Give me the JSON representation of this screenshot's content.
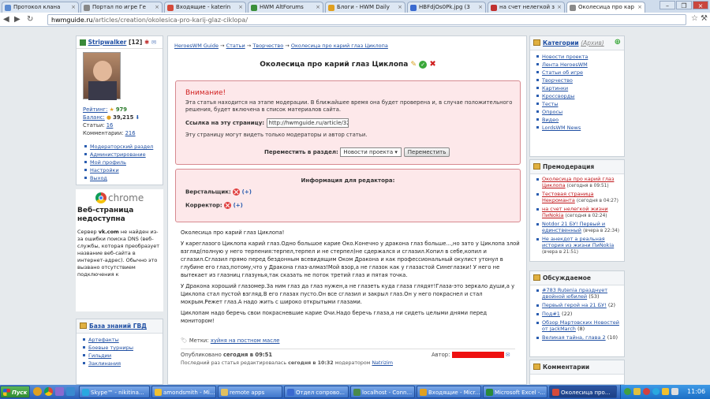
{
  "tabs": [
    {
      "label": "Протокол клана",
      "color": "#5b8ad0"
    },
    {
      "label": "Портал по игре Ге",
      "color": "#888"
    },
    {
      "label": "Входящие - katerin",
      "color": "#d54a3a"
    },
    {
      "label": "HWM AltForums",
      "color": "#3a8f3a"
    },
    {
      "label": "Блоги - HWM Daily",
      "color": "#e0a020"
    },
    {
      "label": "HBFdjOs0Pk.jpg (3",
      "color": "#3a6ad0"
    },
    {
      "label": "на счет нелегкой з",
      "color": "#c03030"
    },
    {
      "label": "Околесица про кар",
      "color": "#8a8a8a"
    }
  ],
  "address": {
    "domain": "hwmguide.ru",
    "path": "/articles/creation/okolesica-pro-karij-glaz-ciklopa/"
  },
  "user": {
    "name": "Stripwalker",
    "level": "[12]",
    "rating_label": "Рейтинг:",
    "rating": "979",
    "balance_label": "Баланс:",
    "balance": "39,215",
    "articles_label": "Статьи:",
    "articles": "16",
    "comments_label": "Комментарии:",
    "comments": "216"
  },
  "user_links": [
    "Модераторский раздел",
    "Администрирование",
    "Мой профиль",
    "Настройки",
    "Выход"
  ],
  "chrome": {
    "brand": "chrome",
    "title": "Веб-страница недоступна",
    "text_pre": "Сервер",
    "text_bold": "vk.com",
    "text_post": "не найден из-за ошибки поиска DNS (веб-службы, которая преобразует название веб-сайта в интернет-адрес). Обычно это вызвано отсутствием подключения к"
  },
  "kb": {
    "title": "База знаний ГВД",
    "items": [
      "Артефакты",
      "Боевые турниры",
      "Гильдии",
      "Заклинания"
    ]
  },
  "breadcrumb": [
    "HeroesWM Guide",
    "Статьи",
    "Творчество",
    "Околесица про карий глаз Циклопа"
  ],
  "article": {
    "title": "Околесица про карий глаз Циклопа",
    "warn_title": "Внимание!",
    "warn_text": "Эта статья находится на этапе модерации. В ближайшее время она будет проверена и, в случае положительного решения, будет включена в список материалов сайта.",
    "link_label": "Ссылка на эту страницу:",
    "link_value": "http://hwmguide.ru/article/3269/",
    "mod_text": "Эту страницу могут видеть только модераторы и автор статьи.",
    "move_label": "Переместить в раздел:",
    "move_option": "Новости проекта",
    "move_button": "Переместить",
    "editor_title": "Информация для редактора:",
    "layout_label": "Верстальщик:",
    "corrector_label": "Корректор:",
    "p1": "Околесица про карий глаз Циклопа!",
    "p2": "У кареглазого Циклопа карий глаз.Одно большое карие Око.Конечно у дракона глаз больше...,но зато у Циклопа злой взгляд(полную у него терпения:терпел,терпел и не стерпел)не сдержался и сглазил.Копил в себе,копил и сглазил.Сглазил прямо перед бездонным всевидящим Оком Дракона и как профессиональный окулист утонул в глубине его глаз,потому,что у Дракона глаз-алмаз!Мой взор,а не глазок как у глазастой Синеглазки! У него не вытекает из глазниц глазунья,так сказать не поток третий глаз и пятая точка.",
    "p3": "У Дракона хороший глазомер.За ним глаз да глаз нужен,а не глазеть куда глаза глядят!Глаза-это зеркало души,а у Циклопа стал пустой взгляд.В его глазах пусто.Он все сглазил и закрыл глаз.Он у него покраснел и стал мокрым.Режет глаз.А надо жить с широко открытыми глазами.",
    "p4": "Циклопам надо беречь свои покрасневшие карие Очи.Надо беречь глаза,а ни сидеть целыми днями перед монитором!",
    "tags_label": "Метки:",
    "tag": "хуйня на постном масле",
    "published_label": "Опубликовано",
    "published": "сегодня в 09:51",
    "author_label": "Автор:",
    "edited_label": "Последний раз статья редактировалась",
    "edited": "сегодня в 10:32",
    "edited_by_label": "модератором",
    "edited_by": "Natrizim"
  },
  "categories": {
    "title": "Категории",
    "archive": "(Архив)",
    "items": [
      "Новости проекта",
      "Лента HeroesWM",
      "Статьи об игре",
      "Творчество",
      "Картинки",
      "Кроссворды",
      "Тесты",
      "Опросы",
      "Видео",
      "LordsWM News"
    ]
  },
  "premod": {
    "title": "Премодерация",
    "items": [
      {
        "title": "Околесица про карий глаз Циклопа",
        "meta": "(сегодня в 09:51)"
      },
      {
        "title": "Тестовая страница Некроманта",
        "meta": "(сегодня в 04:27)"
      },
      {
        "title": "на счет нелегкой жизни ПиNokia",
        "meta": "(сегодня в 02:24)"
      },
      {
        "title": "Notdor 21 БУ! Первый и единственный",
        "meta": "(вчера в 22:34)"
      },
      {
        "title": "Не анекдот а реальная история из жизни ПиNokia",
        "meta": "(вчера в 21:51)"
      }
    ]
  },
  "discussed": {
    "title": "Обсуждаемое",
    "items": [
      {
        "title": "#783 Rutenia празднует двойной юбилей",
        "count": "(53)"
      },
      {
        "title": "Первый герой на 21 БУ!",
        "count": "(2)"
      },
      {
        "title": "Под#1",
        "count": "(22)"
      },
      {
        "title": "Обзор Мартовских Новостей от JackMarch",
        "count": "(8)"
      },
      {
        "title": "Великая тайна, глава 2",
        "count": "(10)"
      }
    ]
  },
  "comments_panel": {
    "title": "Комментарии"
  },
  "taskbar": {
    "start": "Пуск",
    "items": [
      {
        "label": "Skype™ - nikitina...",
        "color": "#29a8e0"
      },
      {
        "label": "amondsmith - Mi...",
        "color": "#f0c030"
      },
      {
        "label": "remote apps",
        "color": "#e0c060"
      },
      {
        "label": "Отдел сопрово...",
        "color": "#3a6ad0"
      },
      {
        "label": "localhost - Conn...",
        "color": "#4a8a4a"
      },
      {
        "label": "Входящие - Micr...",
        "color": "#e0a020"
      },
      {
        "label": "Microsoft Excel -...",
        "color": "#2a8a3a"
      },
      {
        "label": "Околесица про...",
        "color": "#d54a3a"
      }
    ],
    "clock": "11:06"
  }
}
